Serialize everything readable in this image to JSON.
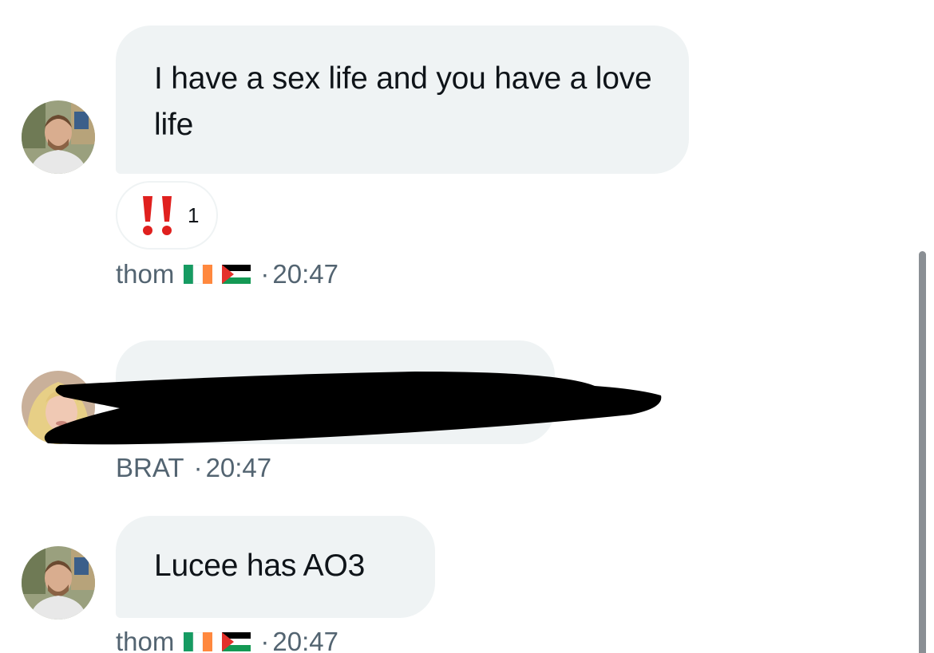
{
  "messages": [
    {
      "text": "I have a sex life and you have a love life",
      "sender": "thom",
      "flags": [
        "ireland-flag-icon",
        "palestine-flag-icon"
      ],
      "separator": "·",
      "time": "20:47",
      "reaction": {
        "emoji": "double-exclamation-icon",
        "count": "1"
      },
      "avatar": "avatar-thom"
    },
    {
      "text": "",
      "redacted": true,
      "sender": "BRAT",
      "separator": "·",
      "time": "20:47",
      "avatar": "avatar-brat"
    },
    {
      "text": "Lucee has AO3",
      "sender": "thom",
      "flags": [
        "ireland-flag-icon",
        "palestine-flag-icon"
      ],
      "separator": "·",
      "time": "20:47",
      "avatar": "avatar-thom"
    }
  ],
  "colors": {
    "bubble": "#eff3f4",
    "text": "#0f1419",
    "meta": "#536471",
    "reaction_red": "#e0201e",
    "redaction": "#000000"
  }
}
